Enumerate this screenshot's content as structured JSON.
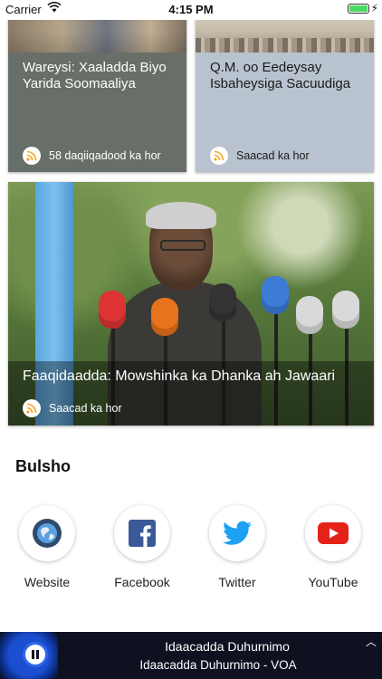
{
  "status_bar": {
    "carrier": "Carrier",
    "time": "4:15 PM"
  },
  "feed": {
    "cards": [
      {
        "title": "Wareysi: Xaaladda Biyo Yarida Soomaaliya",
        "time_ago": "58 daqiiqadood ka hor",
        "background": "#676f68"
      },
      {
        "title": "Q.M. oo Eedeysay Isbaheysiga Sacuudiga",
        "time_ago": "Saacad ka hor",
        "background": "#b9c3cf"
      },
      {
        "title": "Faaqidaadda: Mowshinka ka Dhanka ah Jawaari",
        "time_ago": "Saacad ka hor"
      }
    ]
  },
  "social": {
    "heading": "Bulsho",
    "items": [
      {
        "label": "Website",
        "icon": "globe-icon"
      },
      {
        "label": "Facebook",
        "icon": "facebook-icon",
        "color": "#3b5998"
      },
      {
        "label": "Twitter",
        "icon": "twitter-icon",
        "color": "#1da1f2"
      },
      {
        "label": "YouTube",
        "icon": "youtube-icon",
        "color": "#e62117"
      }
    ]
  },
  "player": {
    "title": "Idaacadda Duhurnimo",
    "subtitle": "Idaacadda Duhurnimo - VOA",
    "state": "playing"
  },
  "colors": {
    "rss_accent": "#f5a623",
    "player_background": "#0d1120"
  }
}
